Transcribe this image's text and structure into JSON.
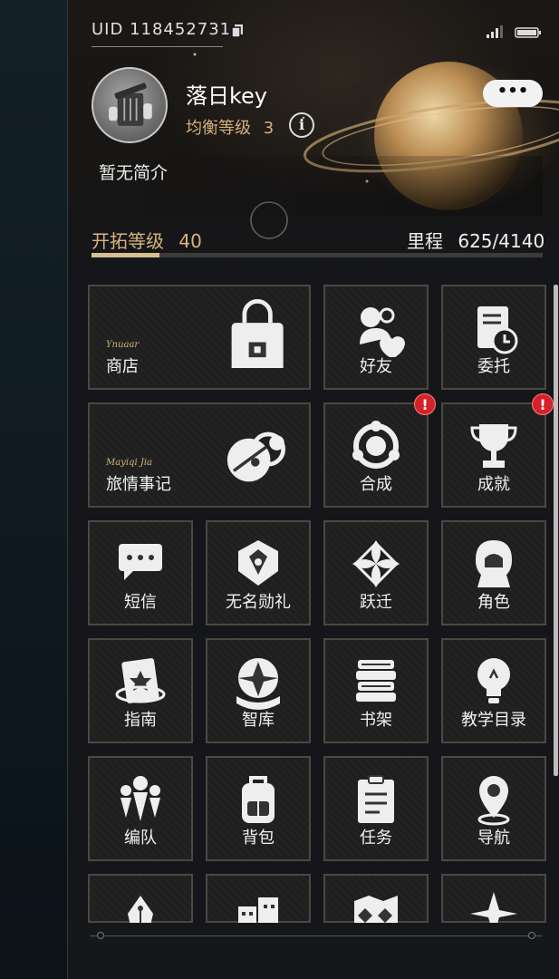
{
  "header": {
    "uid": "UID 118452731",
    "username": "落日key",
    "equilibrium_label": "均衡等级",
    "equilibrium_level": "3",
    "bio": "暂无简介",
    "more_label": "•••",
    "trailblaze_label": "开拓等级",
    "trailblaze_level": "40",
    "mileage_label": "里程",
    "mileage_value": "625/4140",
    "mileage_progress": 0.151
  },
  "icons": {
    "copy": "copy-icon",
    "signal": "signal-icon",
    "battery": "battery-icon",
    "info": "info-icon"
  },
  "menu": [
    {
      "label": "商店",
      "sub": "Ynuaar",
      "icon": "shop-bag-icon",
      "wide": true,
      "badge": false
    },
    {
      "label": "好友",
      "icon": "friends-icon",
      "badge": false
    },
    {
      "label": "委托",
      "icon": "assignment-icon",
      "badge": false
    },
    {
      "label": "旅情事记",
      "sub": "Mayiqi Jia",
      "icon": "journal-orb-icon",
      "wide": true,
      "badge": false
    },
    {
      "label": "合成",
      "icon": "synthesis-icon",
      "badge": true
    },
    {
      "label": "成就",
      "icon": "trophy-icon",
      "badge": true
    },
    {
      "label": "短信",
      "icon": "message-icon",
      "badge": false
    },
    {
      "label": "无名勋礼",
      "icon": "nameless-honor-icon",
      "badge": false
    },
    {
      "label": "跃迁",
      "icon": "warp-icon",
      "badge": false
    },
    {
      "label": "角色",
      "icon": "character-icon",
      "badge": false
    },
    {
      "label": "指南",
      "icon": "guide-icon",
      "badge": false
    },
    {
      "label": "智库",
      "icon": "database-icon",
      "badge": false
    },
    {
      "label": "书架",
      "icon": "bookshelf-icon",
      "badge": false
    },
    {
      "label": "教学目录",
      "icon": "tutorial-bulb-icon",
      "badge": false
    },
    {
      "label": "编队",
      "icon": "team-icon",
      "badge": false
    },
    {
      "label": "背包",
      "icon": "backpack-icon",
      "badge": false
    },
    {
      "label": "任务",
      "icon": "mission-icon",
      "badge": false
    },
    {
      "label": "导航",
      "icon": "navigation-pin-icon",
      "badge": false
    },
    {
      "label": "",
      "icon": "pen-nib-icon",
      "badge": false
    },
    {
      "label": "",
      "icon": "city-icon",
      "badge": false
    },
    {
      "label": "",
      "icon": "map-icon",
      "badge": false
    },
    {
      "label": "",
      "icon": "star-path-icon",
      "badge": false
    }
  ],
  "badge_mark": "!"
}
